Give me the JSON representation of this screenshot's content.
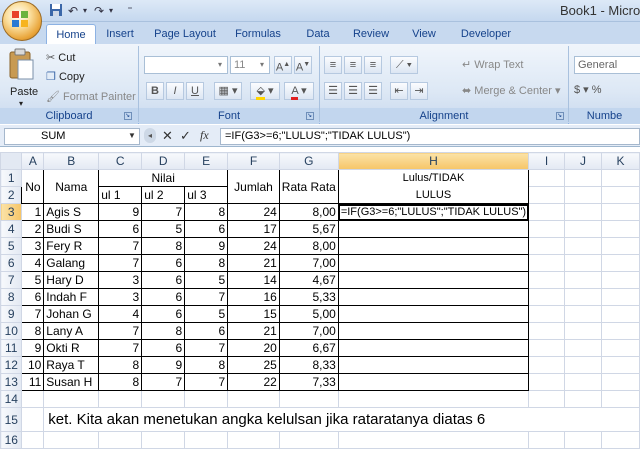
{
  "window": {
    "title": "Book1 - Microso"
  },
  "quick_access": {
    "save_icon": "save-icon",
    "undo_icon": "undo-icon",
    "redo_icon": "redo-icon"
  },
  "tabs": [
    "Home",
    "Insert",
    "Page Layout",
    "Formulas",
    "Data",
    "Review",
    "View",
    "Developer"
  ],
  "ribbon": {
    "clipboard": {
      "paste": "Paste",
      "cut": "Cut",
      "copy": "Copy",
      "format_painter": "Format Painter",
      "label": "Clipboard"
    },
    "font": {
      "size": "11",
      "label": "Font",
      "bold": "B",
      "italic": "I",
      "underline": "U"
    },
    "alignment": {
      "wrap_text": "Wrap Text",
      "merge_center": "Merge & Center",
      "label": "Alignment"
    },
    "number": {
      "format": "General",
      "label": "Numbe"
    }
  },
  "formula_bar": {
    "name_box": "SUM",
    "fx": "fx",
    "formula": "=IF(G3>=6;\"LULUS\";\"TIDAK LULUS\")"
  },
  "sheet": {
    "columns": [
      "A",
      "B",
      "C",
      "D",
      "E",
      "F",
      "G",
      "H",
      "I",
      "J",
      "K"
    ],
    "header": {
      "no": "No",
      "nama": "Nama",
      "nilai": "Nilai",
      "ul1": "ul 1",
      "ul2": "ul 2",
      "ul3": "ul 3",
      "jumlah": "Jumlah",
      "rata": "Rata Rata",
      "lulus1": "Lulus/TIDAK",
      "lulus2": "LULUS"
    },
    "rows": [
      {
        "no": "1",
        "nama": "Agis S",
        "ul1": "9",
        "ul2": "7",
        "ul3": "8",
        "jumlah": "24",
        "rata": "8,00"
      },
      {
        "no": "2",
        "nama": "Budi S",
        "ul1": "6",
        "ul2": "5",
        "ul3": "6",
        "jumlah": "17",
        "rata": "5,67"
      },
      {
        "no": "3",
        "nama": "Fery R",
        "ul1": "7",
        "ul2": "8",
        "ul3": "9",
        "jumlah": "24",
        "rata": "8,00"
      },
      {
        "no": "4",
        "nama": "Galang",
        "ul1": "7",
        "ul2": "6",
        "ul3": "8",
        "jumlah": "21",
        "rata": "7,00"
      },
      {
        "no": "5",
        "nama": "Hary D",
        "ul1": "3",
        "ul2": "6",
        "ul3": "5",
        "jumlah": "14",
        "rata": "4,67"
      },
      {
        "no": "6",
        "nama": "Indah F",
        "ul1": "3",
        "ul2": "6",
        "ul3": "7",
        "jumlah": "16",
        "rata": "5,33"
      },
      {
        "no": "7",
        "nama": "Johan G",
        "ul1": "4",
        "ul2": "6",
        "ul3": "5",
        "jumlah": "15",
        "rata": "5,00"
      },
      {
        "no": "8",
        "nama": "Lany A",
        "ul1": "7",
        "ul2": "8",
        "ul3": "6",
        "jumlah": "21",
        "rata": "7,00"
      },
      {
        "no": "9",
        "nama": "Okti R",
        "ul1": "7",
        "ul2": "6",
        "ul3": "7",
        "jumlah": "20",
        "rata": "6,67"
      },
      {
        "no": "10",
        "nama": "Raya T",
        "ul1": "8",
        "ul2": "9",
        "ul3": "8",
        "jumlah": "25",
        "rata": "8,33"
      },
      {
        "no": "11",
        "nama": "Susan H",
        "ul1": "8",
        "ul2": "7",
        "ul3": "7",
        "jumlah": "22",
        "rata": "7,33"
      }
    ],
    "editing_cell_text": "=IF(G3>=6;\"LULUS\";\"TIDAK LULUS\")",
    "note": "ket. Kita akan menetukan angka kelulsan jika rataratanya diatas 6",
    "row_numbers": [
      "1",
      "2",
      "3",
      "4",
      "5",
      "6",
      "7",
      "8",
      "9",
      "10",
      "11",
      "12",
      "13",
      "14",
      "15",
      "16"
    ]
  }
}
